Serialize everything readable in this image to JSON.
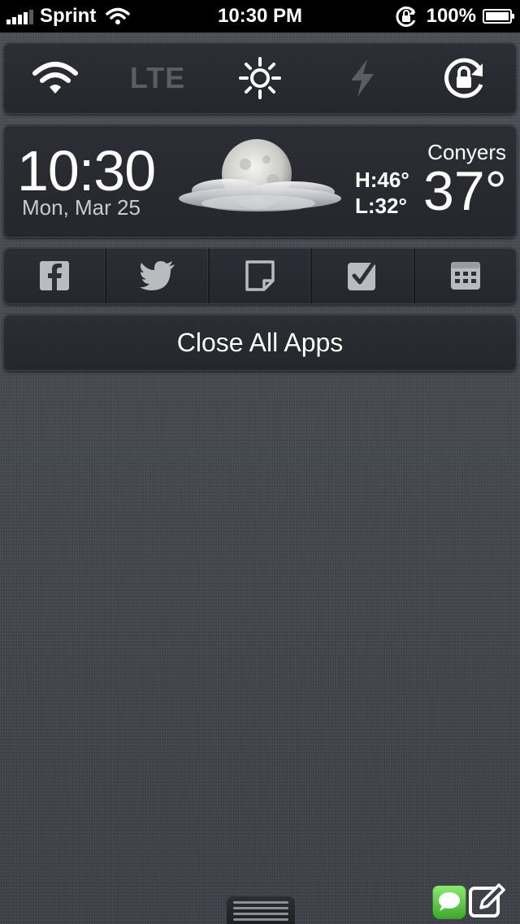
{
  "status_bar": {
    "carrier": "Sprint",
    "time": "10:30 PM",
    "battery": "100%",
    "battery_level": 1.0
  },
  "toggles": {
    "items": [
      {
        "icon": "wifi-icon",
        "state": "on"
      },
      {
        "label": "LTE",
        "state": "off"
      },
      {
        "icon": "brightness-icon",
        "state": "on"
      },
      {
        "icon": "flash-icon",
        "state": "off"
      },
      {
        "icon": "rotation-lock-icon",
        "state": "on"
      }
    ]
  },
  "weather": {
    "time": "10:30",
    "date": "Mon, Mar 25",
    "city": "Conyers",
    "high": "H:46°",
    "low": "L:32°",
    "temp": "37°",
    "condition_icon": "moon-cloud-icon"
  },
  "shortcuts": {
    "items": [
      {
        "icon": "facebook-icon"
      },
      {
        "icon": "twitter-icon"
      },
      {
        "icon": "note-icon"
      },
      {
        "icon": "reminders-icon"
      },
      {
        "icon": "calendar-icon"
      }
    ]
  },
  "close_apps": {
    "label": "Close All Apps"
  },
  "dock": {
    "messages_icon": "messages-icon",
    "compose_icon": "compose-icon"
  },
  "colors": {
    "active_icon": "#ffffff",
    "inactive_icon": "#5a5d64",
    "panel_bg": "#2a2c32",
    "background": "#3e4149"
  }
}
